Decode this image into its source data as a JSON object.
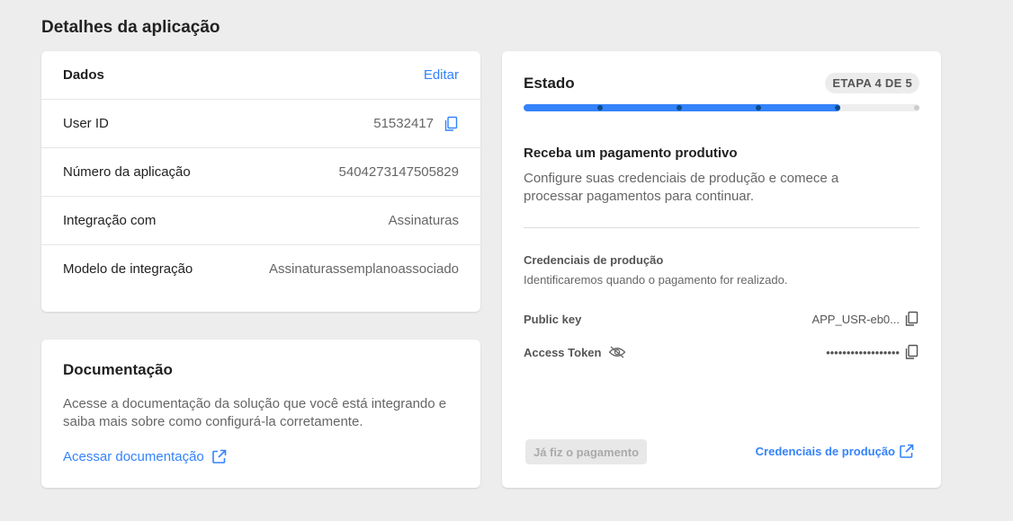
{
  "page": {
    "title": "Detalhes da aplicação"
  },
  "dados": {
    "title": "Dados",
    "edit_label": "Editar",
    "rows": [
      {
        "label": "User ID",
        "value": "51532417"
      },
      {
        "label": "Número da aplicação",
        "value": "5404273147505829"
      },
      {
        "label": "Integração com",
        "value": "Assinaturas"
      },
      {
        "label": "Modelo de integração",
        "value": "Assinaturassemplanoassociado"
      }
    ]
  },
  "documentacao": {
    "title": "Documentação",
    "text": "Acesse a documentação da solução que você está integrando e saiba mais sobre como configurá-la corretamente.",
    "link_label": "Acessar documentação"
  },
  "estado": {
    "title": "Estado",
    "step_badge": "ETAPA 4 DE 5",
    "step_current": 4,
    "step_total": 5,
    "subtitle": "Receba um pagamento produtivo",
    "text": "Configure suas credenciais de produção e comece a processar pagamentos para continuar.",
    "credentials": {
      "title": "Credenciais de produção",
      "description": "Identificaremos quando o pagamento for realizado.",
      "public_key_label": "Public key",
      "public_key_value": "APP_USR-eb0...",
      "access_token_label": "Access Token",
      "access_token_value": "••••••••••••••••••"
    },
    "paid_button_label": "Já fiz o pagamento",
    "prod_link_label": "Credenciais de produção"
  },
  "colors": {
    "accent": "#3483fa",
    "background": "#ededed"
  }
}
